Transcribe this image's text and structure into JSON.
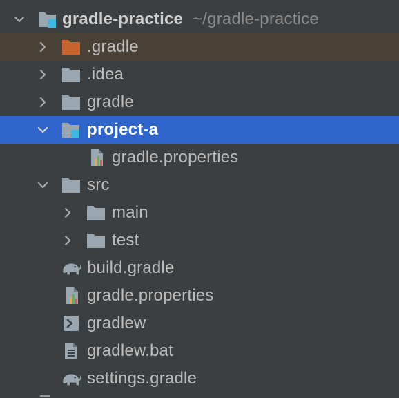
{
  "tree": {
    "root": {
      "label": "gradle-practice",
      "hint": "~/gradle-practice",
      "icon": "module-folder-icon"
    },
    "items": [
      {
        "label": ".gradle",
        "icon": "excluded-folder-icon"
      },
      {
        "label": ".idea",
        "icon": "folder-icon"
      },
      {
        "label": "gradle",
        "icon": "folder-icon"
      },
      {
        "label": "project-a",
        "icon": "module-folder-icon"
      },
      {
        "label": "gradle.properties",
        "icon": "properties-file-icon"
      },
      {
        "label": "src",
        "icon": "folder-icon"
      },
      {
        "label": "main",
        "icon": "folder-icon"
      },
      {
        "label": "test",
        "icon": "folder-icon"
      },
      {
        "label": "build.gradle",
        "icon": "gradle-elephant-icon"
      },
      {
        "label": "gradle.properties",
        "icon": "properties-file-icon"
      },
      {
        "label": "gradlew",
        "icon": "shell-script-icon"
      },
      {
        "label": "gradlew.bat",
        "icon": "text-file-icon"
      },
      {
        "label": "settings.gradle",
        "icon": "gradle-elephant-icon"
      }
    ]
  },
  "colors": {
    "background": "#3c3f41",
    "selection": "#2f65ca",
    "excluded_row": "#4a4136",
    "folder": "#9aa7b0",
    "excluded_folder": "#c8632d",
    "module_badge": "#40b6e0",
    "text": "#bbbbbb"
  }
}
